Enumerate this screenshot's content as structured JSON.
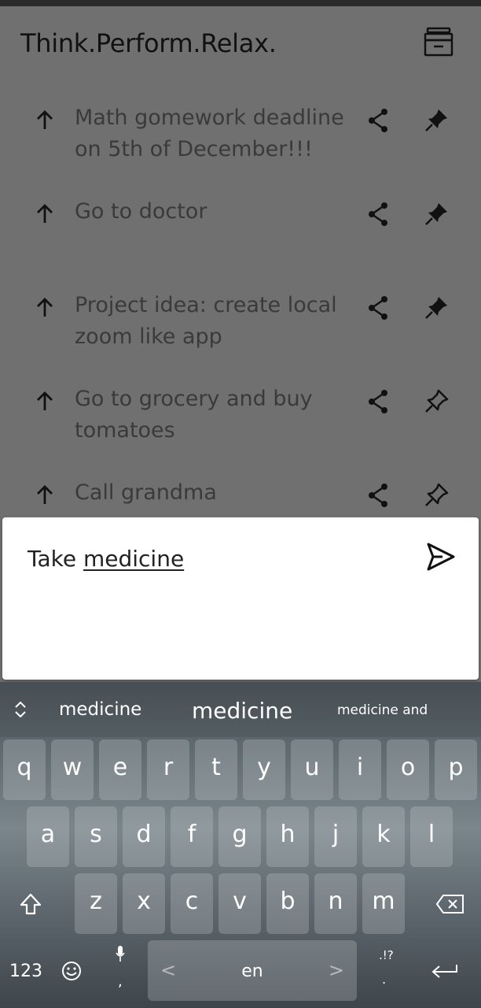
{
  "app": {
    "title": "Think.Perform.Relax."
  },
  "tasks": [
    {
      "text_line1": "Math gomework deadline",
      "text_line2": "on 5th of  December!!!",
      "pinned": true
    },
    {
      "text_line1": "Go to doctor",
      "text_line2": "",
      "pinned": true
    },
    {
      "text_line1": "Project idea: create local",
      "text_line2": "zoom like  app",
      "pinned": true
    },
    {
      "text_line1": "Go to grocery and buy",
      "text_line2": "tomatoes",
      "pinned": false
    },
    {
      "text_line1": "Call grandma",
      "text_line2": "",
      "pinned": false
    }
  ],
  "composer": {
    "word1": "Take",
    "word2": "medicine"
  },
  "keyboard": {
    "suggestions": [
      "medicine",
      "medicine",
      "medicine and"
    ],
    "row1": [
      "q",
      "w",
      "e",
      "r",
      "t",
      "y",
      "u",
      "i",
      "o",
      "p"
    ],
    "row2": [
      "a",
      "s",
      "d",
      "f",
      "g",
      "h",
      "j",
      "k",
      "l"
    ],
    "row3": [
      "z",
      "x",
      "c",
      "v",
      "b",
      "n",
      "m"
    ],
    "num_label": "123",
    "space_label": "en",
    "punct_label": ".!?",
    "comma_label": ",",
    "period_label": "."
  },
  "icons": {
    "archive": "archive-icon",
    "arrow": "arrow-up-icon",
    "share": "share-icon",
    "pin": "pin-icon",
    "send": "send-icon"
  }
}
